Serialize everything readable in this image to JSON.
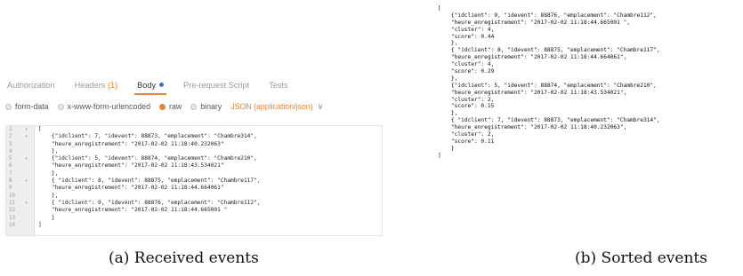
{
  "left": {
    "tabs": [
      {
        "label": "Authorization",
        "count": "",
        "active": false
      },
      {
        "label": "Headers",
        "count": "(1)",
        "active": false
      },
      {
        "label": "Body",
        "count": "",
        "active": true
      },
      {
        "label": "Pre-request Script",
        "count": "",
        "active": false
      },
      {
        "label": "Tests",
        "count": "",
        "active": false
      }
    ],
    "body_options": [
      {
        "label": "form-data",
        "checked": false
      },
      {
        "label": "x-www-form-urlencoded",
        "checked": false
      },
      {
        "label": "raw",
        "checked": true
      },
      {
        "label": "binary",
        "checked": false
      }
    ],
    "content_type": "JSON (application/json)",
    "line_numbers": [
      "1",
      "2",
      "3",
      "4",
      "5",
      "6",
      "7",
      "8",
      "9",
      "10",
      "11",
      "12",
      "13",
      "14"
    ],
    "code_lines": [
      "[",
      "    {\"idclient\": 7, \"idevent\": 88873, \"emplacement\": \"Chambre314\",",
      "    \"heure_enregistrement\": \"2017-02-02 11:18:40.232063\"",
      "    },",
      "    {\"idclient\": 5, \"idevent\": 88874, \"emplacement\": \"Chambre210\",",
      "    \"heure_enregistrement\": \"2017-02-02 11:18:43.534021\"",
      "    },",
      "    { \"idclient\": 8, \"idevent\": 88875, \"emplacement\": \"Chambre117\",",
      "    \"heure_enregistrement\": \"2017-02-02 11:18:44.664061\"",
      "    },",
      "    { \"idclient\": 9, \"idevent\": 88876, \"emplacement\": \"Chambre112\",",
      "    \"heure_enregistrement\": \"2017-02-02 11:18:44.665001 \"",
      "    }",
      "]"
    ],
    "caption": "(a) Received events"
  },
  "right": {
    "output_lines": [
      "[",
      "    {\"idclient\": 9, \"idevent\": 88876, \"emplacement\": \"Chambre112\",",
      "    \"heure_enregistrement\": \"2017-02-02 11:18:44.665001 \",",
      "    \"cluster\": 4,",
      "    \"score\": 0.44",
      "    },",
      "    { \"idclient\": 8, \"idevent\": 88875, \"emplacement\": \"Chambre117\",",
      "    \"heure_enregistrement\": \"2017-02-02 11:18:44.664061\",",
      "    \"cluster\": 4,",
      "    \"score\": 0.29",
      "    },",
      "    {\"idclient\": 5, \"idevent\": 88874, \"emplacement\": \"Chambre210\",",
      "    \"heure_enregistrement\": \"2017-02-02 11:18:43.534021\",",
      "    \"cluster\": 2,",
      "    \"score\": 0.15",
      "    },",
      "    { \"idclient\": 7, \"idevent\": 88873, \"emplacement\": \"Chambre314\",",
      "    \"heure_enregistrement\": \"2017-02-02 11:18:40.232063\",",
      "    \"cluster\": 2,",
      "    \"score\": 0.11",
      "    }",
      "]"
    ],
    "caption": "(b) Sorted events"
  },
  "colors": {
    "accent": "#e8833a",
    "active_dot": "#2a7ae2"
  }
}
